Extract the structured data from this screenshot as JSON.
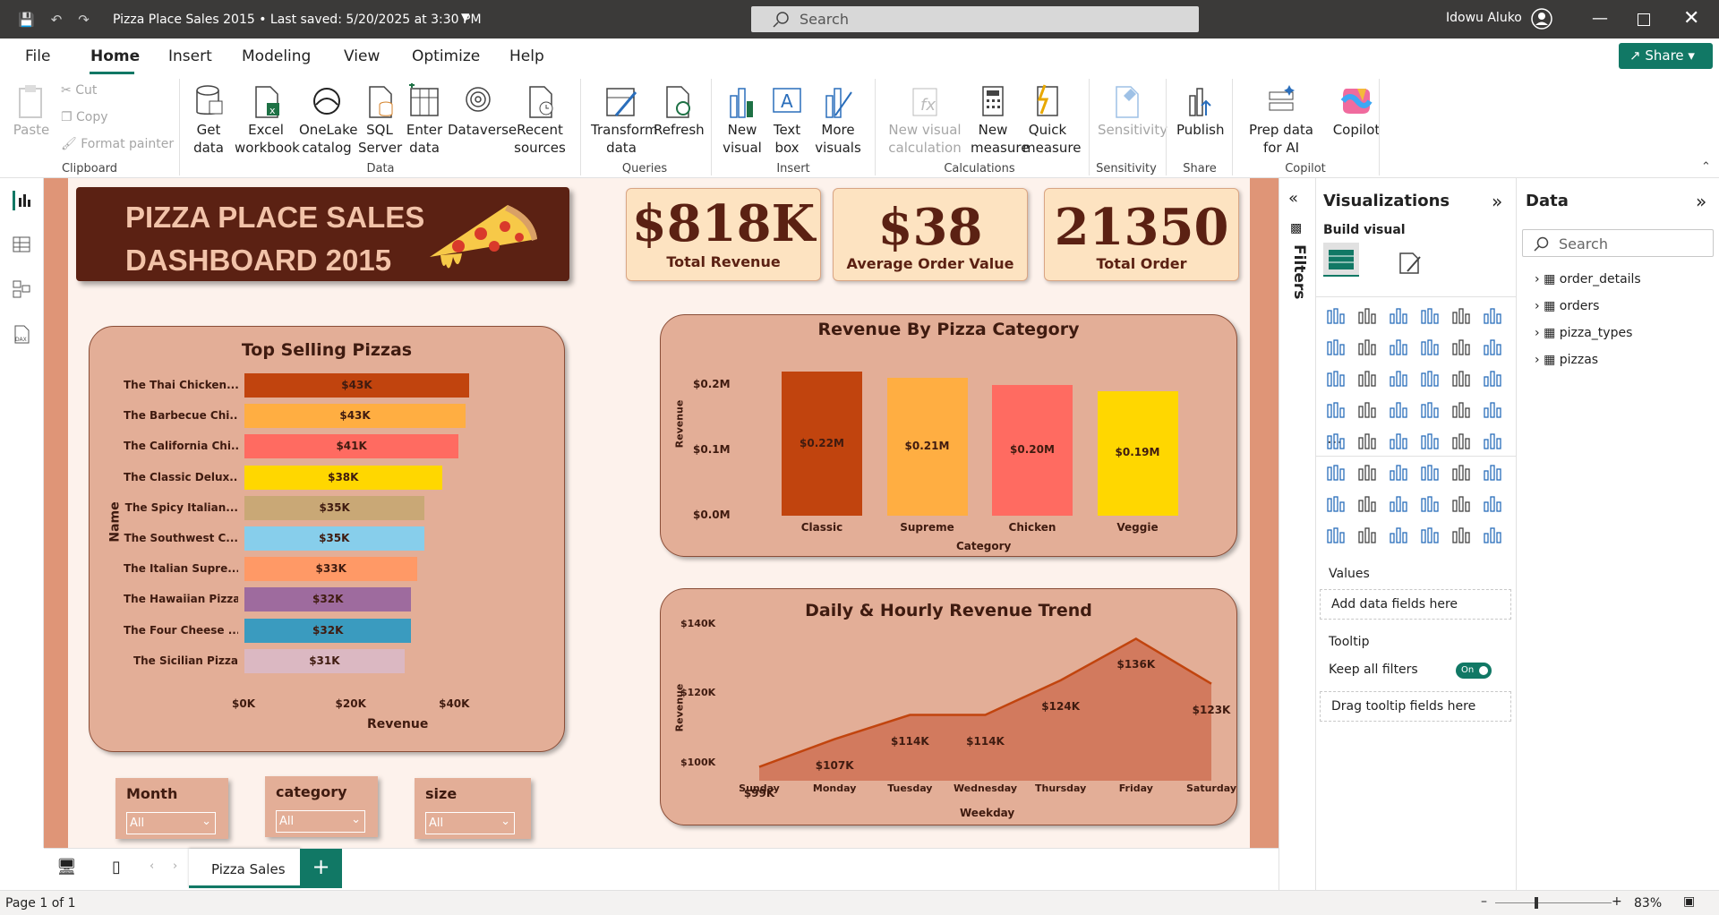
{
  "titlebar": {
    "title": "Pizza Place Sales 2015 • Last saved: 5/20/2025 at 3:30 PM",
    "search": "Search",
    "user": "Idowu Aluko"
  },
  "menu": {
    "items": [
      "File",
      "Home",
      "Insert",
      "Modeling",
      "View",
      "Optimize",
      "Help"
    ],
    "share": "Share"
  },
  "ribbon": {
    "paste": "Paste",
    "cut": "Cut",
    "copy": "Copy",
    "format_painter": "Format painter",
    "clipboard": "Clipboard",
    "get_data": "Get data",
    "excel": "Excel workbook",
    "onelake": "OneLake catalog",
    "sql": "SQL Server",
    "enter_data": "Enter data",
    "dataverse": "Dataverse",
    "recent": "Recent sources",
    "data": "Data",
    "transform": "Transform data",
    "refresh": "Refresh",
    "queries": "Queries",
    "new_visual": "New visual",
    "text_box": "Text box",
    "more_visuals": "More visuals",
    "insert": "Insert",
    "new_visual_calc": "New visual calculation",
    "new_measure": "New measure",
    "quick_measure": "Quick measure",
    "calculations": "Calculations",
    "sensitivity_btn": "Sensitivity",
    "sensitivity": "Sensitivity",
    "publish": "Publish",
    "share": "Share",
    "prep": "Prep data for AI",
    "copilot_btn": "Copilot",
    "copilot": "Copilot"
  },
  "dashboard": {
    "title_line1": "PIZZA PLACE SALES",
    "title_line2": "DASHBOARD 2015",
    "kpis": [
      {
        "value": "$818K",
        "label": "Total Revenue"
      },
      {
        "value": "$38",
        "label": "Average Order Value"
      },
      {
        "value": "21350",
        "label": "Total Order"
      }
    ],
    "slicers": [
      {
        "label": "Month",
        "value": "All"
      },
      {
        "label": "category",
        "value": "All"
      },
      {
        "label": "size",
        "value": "All"
      }
    ]
  },
  "chart_data": [
    {
      "type": "bar",
      "orientation": "horizontal",
      "title": "Top Selling Pizzas",
      "xlabel": "Revenue",
      "ylabel": "Name",
      "categories": [
        "The Thai Chicken...",
        "The Barbecue Chi...",
        "The California Chi...",
        "The Classic Delux...",
        "The Spicy Italian...",
        "The Southwest C...",
        "The Italian Supre...",
        "The Hawaiian Pizza",
        "The Four Cheese ...",
        "The Sicilian Pizza"
      ],
      "values": [
        43434,
        42768,
        41410,
        38180,
        34832,
        34706,
        33476,
        32273,
        32266,
        30940
      ],
      "labels": [
        "$43K",
        "$43K",
        "$41K",
        "$38K",
        "$35K",
        "$35K",
        "$33K",
        "$32K",
        "$32K",
        "$31K"
      ],
      "colors": [
        "#c1440e",
        "#ffae42",
        "#ff6b61",
        "#ffd700",
        "#c9a876",
        "#87ceeb",
        "#ff9966",
        "#9e6b9e",
        "#3a9bbf",
        "#dbb8c2"
      ],
      "xticks": [
        "$0K",
        "$20K",
        "$40K"
      ],
      "xlim": [
        0,
        45000
      ]
    },
    {
      "type": "bar",
      "title": "Revenue By Pizza Category",
      "xlabel": "Category",
      "ylabel": "Revenue",
      "categories": [
        "Classic",
        "Supreme",
        "Chicken",
        "Veggie"
      ],
      "values": [
        0.22,
        0.21,
        0.2,
        0.19
      ],
      "labels": [
        "$0.22M",
        "$0.21M",
        "$0.20M",
        "$0.19M"
      ],
      "colors": [
        "#c1440e",
        "#ffae42",
        "#ff6b61",
        "#ffd700"
      ],
      "yticks": [
        "$0.0M",
        "$0.1M",
        "$0.2M"
      ],
      "ylim": [
        0,
        0.22
      ]
    },
    {
      "type": "area",
      "title": "Daily & Hourly Revenue Trend",
      "xlabel": "Weekday",
      "ylabel": "Revenue",
      "categories": [
        "Sunday",
        "Monday",
        "Tuesday",
        "Wednesday",
        "Thursday",
        "Friday",
        "Saturday"
      ],
      "values": [
        99,
        107,
        114,
        114,
        124,
        136,
        123
      ],
      "labels": [
        "$99K",
        "$107K",
        "$114K",
        "$114K",
        "$124K",
        "$136K",
        "$123K"
      ],
      "yticks": [
        "$100K",
        "$120K",
        "$140K"
      ],
      "ylim": [
        95,
        140
      ],
      "color": "#c1440e"
    }
  ],
  "pages": {
    "tab": "Pizza Sales",
    "add": "+"
  },
  "viz": {
    "title": "Visualizations",
    "build": "Build visual",
    "values": "Values",
    "values_ph": "Add data fields here",
    "tooltip": "Tooltip",
    "keep": "Keep all filters",
    "toggle": "On",
    "tooltip_ph": "Drag tooltip fields here",
    "more": "..."
  },
  "filters": {
    "label": "Filters"
  },
  "data": {
    "title": "Data",
    "search": "Search",
    "tables": [
      "order_details",
      "orders",
      "pizza_types",
      "pizzas"
    ]
  },
  "status": {
    "page": "Page 1 of 1",
    "zoom": "83%"
  }
}
